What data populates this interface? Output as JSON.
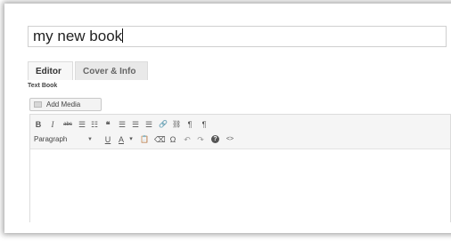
{
  "post": {
    "title_value": "my new book"
  },
  "tabs": [
    {
      "label": "Editor",
      "active": true
    },
    {
      "label": "Cover & Info",
      "active": false
    }
  ],
  "editor": {
    "label": "Text Book",
    "add_media_label": "Add Media",
    "format_select": "Paragraph",
    "toolbar_row1": [
      {
        "name": "bold-icon",
        "glyph": "B"
      },
      {
        "name": "italic-icon",
        "glyph": "I"
      },
      {
        "name": "strikethrough-icon",
        "glyph": "abc"
      },
      {
        "name": "bullet-list-icon",
        "glyph": "☰"
      },
      {
        "name": "numbered-list-icon",
        "glyph": "☷"
      },
      {
        "name": "blockquote-icon",
        "glyph": "❝"
      },
      {
        "name": "align-left-icon",
        "glyph": "☰"
      },
      {
        "name": "align-center-icon",
        "glyph": "☰"
      },
      {
        "name": "align-right-icon",
        "glyph": "☰"
      },
      {
        "name": "insert-link-icon",
        "glyph": "🔗"
      },
      {
        "name": "unlink-icon",
        "glyph": "⛓"
      },
      {
        "name": "toolbar-toggle-icon",
        "glyph": "¶"
      },
      {
        "name": "paragraph-icon",
        "glyph": "¶"
      }
    ],
    "toolbar_row2": [
      {
        "name": "underline-icon",
        "glyph": "U"
      },
      {
        "name": "text-color-icon",
        "glyph": "A"
      },
      {
        "name": "text-color-dropdown-icon",
        "glyph": "▾"
      },
      {
        "name": "paste-text-icon",
        "glyph": "📋"
      },
      {
        "name": "clear-formatting-icon",
        "glyph": "⌫"
      },
      {
        "name": "special-character-icon",
        "glyph": "Ω"
      },
      {
        "name": "undo-icon",
        "glyph": "↶"
      },
      {
        "name": "redo-icon",
        "glyph": "↷"
      },
      {
        "name": "help-icon",
        "glyph": "?"
      },
      {
        "name": "code-icon",
        "glyph": "<>"
      }
    ]
  }
}
